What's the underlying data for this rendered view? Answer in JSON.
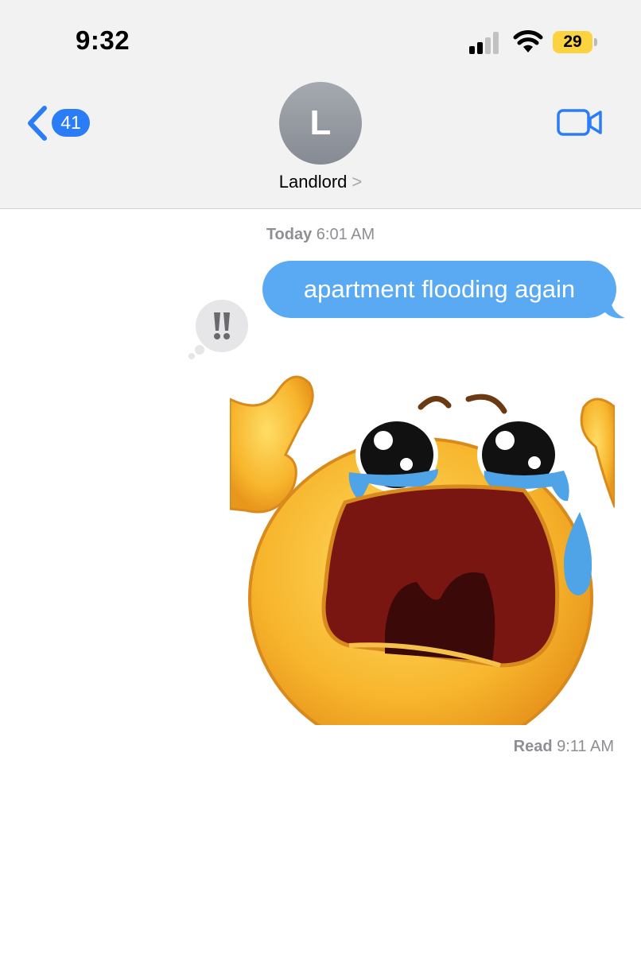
{
  "status_bar": {
    "time": "9:32",
    "battery": "29",
    "battery_color": "#fbd33f",
    "icons": [
      "cellular-signal-icon",
      "wifi-icon",
      "battery-icon"
    ]
  },
  "header": {
    "back_badge": "41",
    "avatar_initial": "L",
    "contact_name": "Landlord",
    "contact_chevron": ">",
    "icons": [
      "back-chevron-icon",
      "video-call-icon"
    ],
    "accent_color": "#2a7cf7"
  },
  "conversation": {
    "timestamp_day": "Today",
    "timestamp_time": "6:01 AM",
    "message_text": "apartment flooding again",
    "bubble_color": "#59aaf2",
    "tapback_icon": "double-exclamation-icon",
    "sticker": "crying-face-sticker",
    "read_label": "Read",
    "read_time": "9:11 AM"
  }
}
